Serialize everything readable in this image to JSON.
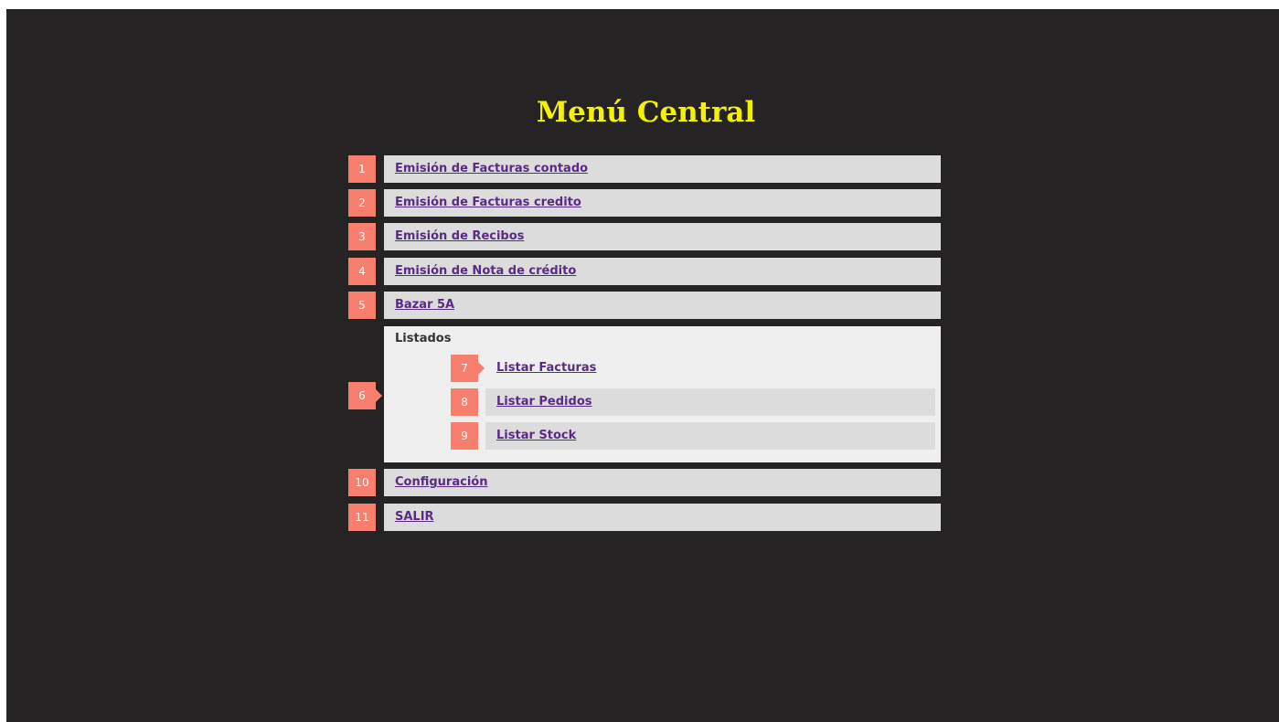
{
  "title": "Menú Central",
  "menu": {
    "items": [
      {
        "number": "1",
        "label": "Emisión de Facturas contado"
      },
      {
        "number": "2",
        "label": "Emisión de Facturas credito"
      },
      {
        "number": "3",
        "label": "Emisión de Recibos"
      },
      {
        "number": "4",
        "label": "Emisión de Nota de crédito"
      },
      {
        "number": "5",
        "label": "Bazar 5A"
      }
    ],
    "group": {
      "number": "6",
      "label": "Listados",
      "items": [
        {
          "number": "7",
          "label": "Listar Facturas"
        },
        {
          "number": "8",
          "label": "Listar Pedidos"
        },
        {
          "number": "9",
          "label": "Listar Stock"
        }
      ]
    },
    "footer_items": [
      {
        "number": "10",
        "label": "Configuración"
      },
      {
        "number": "11",
        "label": "SALIR"
      }
    ]
  },
  "colors": {
    "background": "#252324",
    "title": "#f5f200",
    "number_badge": "#f87e6e",
    "item_bar": "#dcdcdc",
    "group_panel": "#efefef",
    "link": "#5b2a86"
  }
}
